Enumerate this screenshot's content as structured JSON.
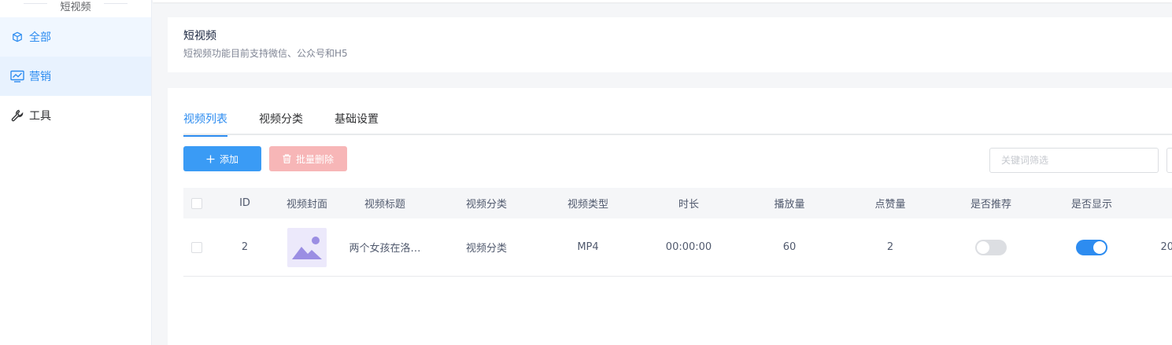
{
  "sidebar": {
    "title": "短视频",
    "items": [
      {
        "label": "全部",
        "icon": "cube-icon"
      },
      {
        "label": "营销",
        "icon": "chart-line-icon"
      },
      {
        "label": "工具",
        "icon": "wrench-icon"
      }
    ]
  },
  "header": {
    "title": "短视频",
    "subtitle": "短视频功能目前支持微信、公众号和H5"
  },
  "tabs": [
    {
      "label": "视频列表",
      "active": true
    },
    {
      "label": "视频分类",
      "active": false
    },
    {
      "label": "基础设置",
      "active": false
    }
  ],
  "toolbar": {
    "add_label": "添加",
    "batch_delete_label": "批量删除",
    "search_placeholder": "关键词筛选"
  },
  "table": {
    "columns": [
      "ID",
      "视频封面",
      "视频标题",
      "视频分类",
      "视频类型",
      "时长",
      "播放量",
      "点赞量",
      "是否推荐",
      "是否显示"
    ],
    "rows": [
      {
        "id": "2",
        "title": "两个女孩在洛…",
        "category": "视频分类",
        "type": "MP4",
        "duration": "00:00:00",
        "plays": "60",
        "likes": "2",
        "recommended": false,
        "shown": true,
        "date_partial": "20"
      }
    ]
  },
  "colors": {
    "primary": "#2d8cf0",
    "danger_disabled": "#f7b6b7",
    "thumb_bg": "#ece9fb",
    "thumb_icon": "#9b8ee3"
  }
}
